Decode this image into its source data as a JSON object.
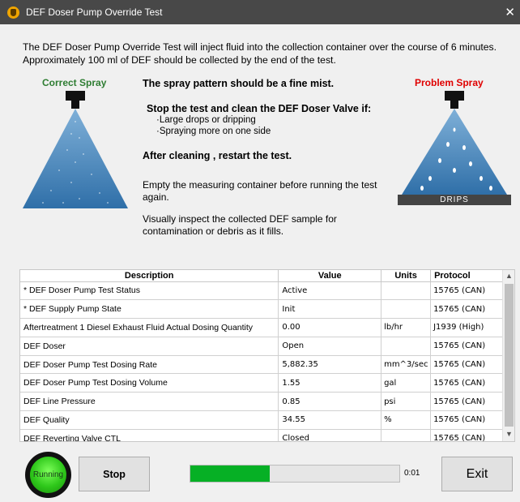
{
  "window": {
    "title": "DEF Doser Pump Override Test",
    "close": "✕"
  },
  "intro": "The DEF Doser Pump Override Test will inject fluid into the collection container over the course of 6 minutes. Approximately 100 ml of DEF should be collected by the end of the test.",
  "correct_label": "Correct Spray",
  "problem_label": "Problem Spray",
  "drips_label": "DRIPS",
  "instructions": {
    "spray_pattern": "The spray pattern should be a fine mist.",
    "stop_clean": "Stop the test and clean the DEF Doser Valve if:",
    "bullet1": "·Large drops or dripping",
    "bullet2": "·Spraying more on one side",
    "after_cleaning": "After cleaning , restart the test.",
    "empty_line1": "Empty the measuring container before running the test",
    "empty_line2": "again.",
    "inspect_line1": "Visually inspect the collected DEF sample for",
    "inspect_line2": "contamination or debris as it fills."
  },
  "table": {
    "headers": {
      "description": "Description",
      "value": "Value",
      "units": "Units",
      "protocol": "Protocol"
    },
    "rows": [
      {
        "description": "* DEF Doser Pump Test Status",
        "value": "Active",
        "units": "",
        "protocol": "15765 (CAN)"
      },
      {
        "description": "* DEF Supply Pump State",
        "value": "Init",
        "units": "",
        "protocol": "15765 (CAN)"
      },
      {
        "description": "Aftertreatment 1 Diesel Exhaust Fluid Actual Dosing Quantity",
        "value": "0.00",
        "units": "lb/hr",
        "protocol": "J1939 (High)"
      },
      {
        "description": "DEF Doser",
        "value": "Open",
        "units": "",
        "protocol": "15765 (CAN)"
      },
      {
        "description": "DEF Doser Pump Test Dosing Rate",
        "value": "5,882.35",
        "units": "mm^3/sec",
        "protocol": "15765 (CAN)"
      },
      {
        "description": "DEF Doser Pump Test Dosing Volume",
        "value": "1.55",
        "units": "gal",
        "protocol": "15765 (CAN)"
      },
      {
        "description": "DEF Line Pressure",
        "value": "0.85",
        "units": "psi",
        "protocol": "15765 (CAN)"
      },
      {
        "description": "DEF Quality",
        "value": "34.55",
        "units": "%",
        "protocol": "15765 (CAN)"
      },
      {
        "description": "DEF Reverting Valve CTL",
        "value": "Closed",
        "units": "",
        "protocol": "15765 (CAN)"
      }
    ]
  },
  "status": {
    "running_label": "Running",
    "stop_label": "Stop",
    "exit_label": "Exit",
    "elapsed": "0:01",
    "progress_fraction": 0.38
  },
  "colors": {
    "titlebar": "#484848",
    "correct": "#2e7d32",
    "problem": "#e00000",
    "progress": "#06b025",
    "spray": "#2f6fa8"
  }
}
